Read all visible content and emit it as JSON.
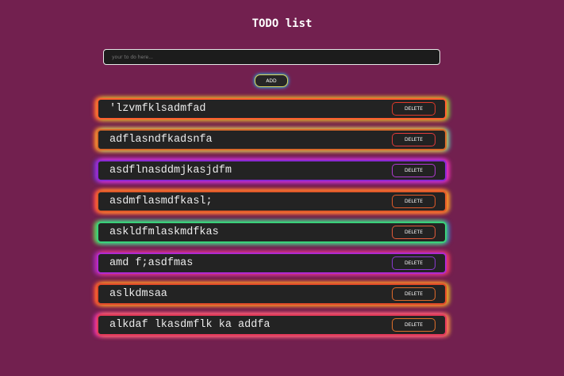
{
  "header": {
    "title": "TODO list"
  },
  "form": {
    "placeholder": "your to do here...",
    "value": "",
    "add_label": "ADD"
  },
  "todos": [
    {
      "text": "'lzvmfklsadmfad",
      "delete_label": "DELETE"
    },
    {
      "text": "adflasndfkadsnfa",
      "delete_label": "DELETE"
    },
    {
      "text": "asdflnasddmjkasjdfm",
      "delete_label": "DELETE"
    },
    {
      "text": "asdmflasmdfkasl;",
      "delete_label": "DELETE"
    },
    {
      "text": "askldfmlaskmdfkas",
      "delete_label": "DELETE"
    },
    {
      "text": "amd f;asdfmas",
      "delete_label": "DELETE"
    },
    {
      "text": "aslkdmsaa",
      "delete_label": "DELETE"
    },
    {
      "text": "alkdaf lkasdmflk ka addfa",
      "delete_label": "DELETE"
    }
  ],
  "colors": {
    "background": "#72204f",
    "item_background": "#232323",
    "text": "#ececec"
  }
}
